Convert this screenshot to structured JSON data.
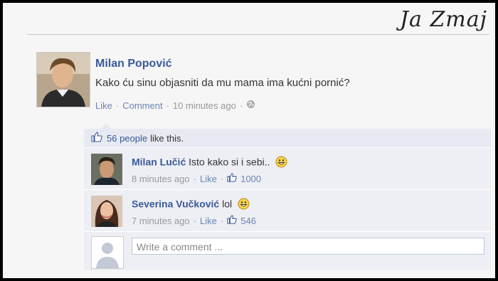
{
  "brand": {
    "signature": "Ja Zmaj"
  },
  "post": {
    "author": "Milan Popović",
    "message": "Kako ću sinu objasniti da mu mama ima kućni pornić?",
    "like_label": "Like",
    "comment_label": "Comment",
    "timestamp": "10 minutes ago"
  },
  "likes": {
    "count_text": "56 people",
    "suffix": "like this."
  },
  "comments": [
    {
      "author": "Milan Lučić",
      "text": "Isto kako si i sebi..",
      "time": "8 minutes ago",
      "like_label": "Like",
      "like_count": "1000"
    },
    {
      "author": "Severina Vučković",
      "text": "lol",
      "time": "7 minutes ago",
      "like_label": "Like",
      "like_count": "546"
    }
  ],
  "write_comment": {
    "placeholder": "Write a comment ..."
  }
}
